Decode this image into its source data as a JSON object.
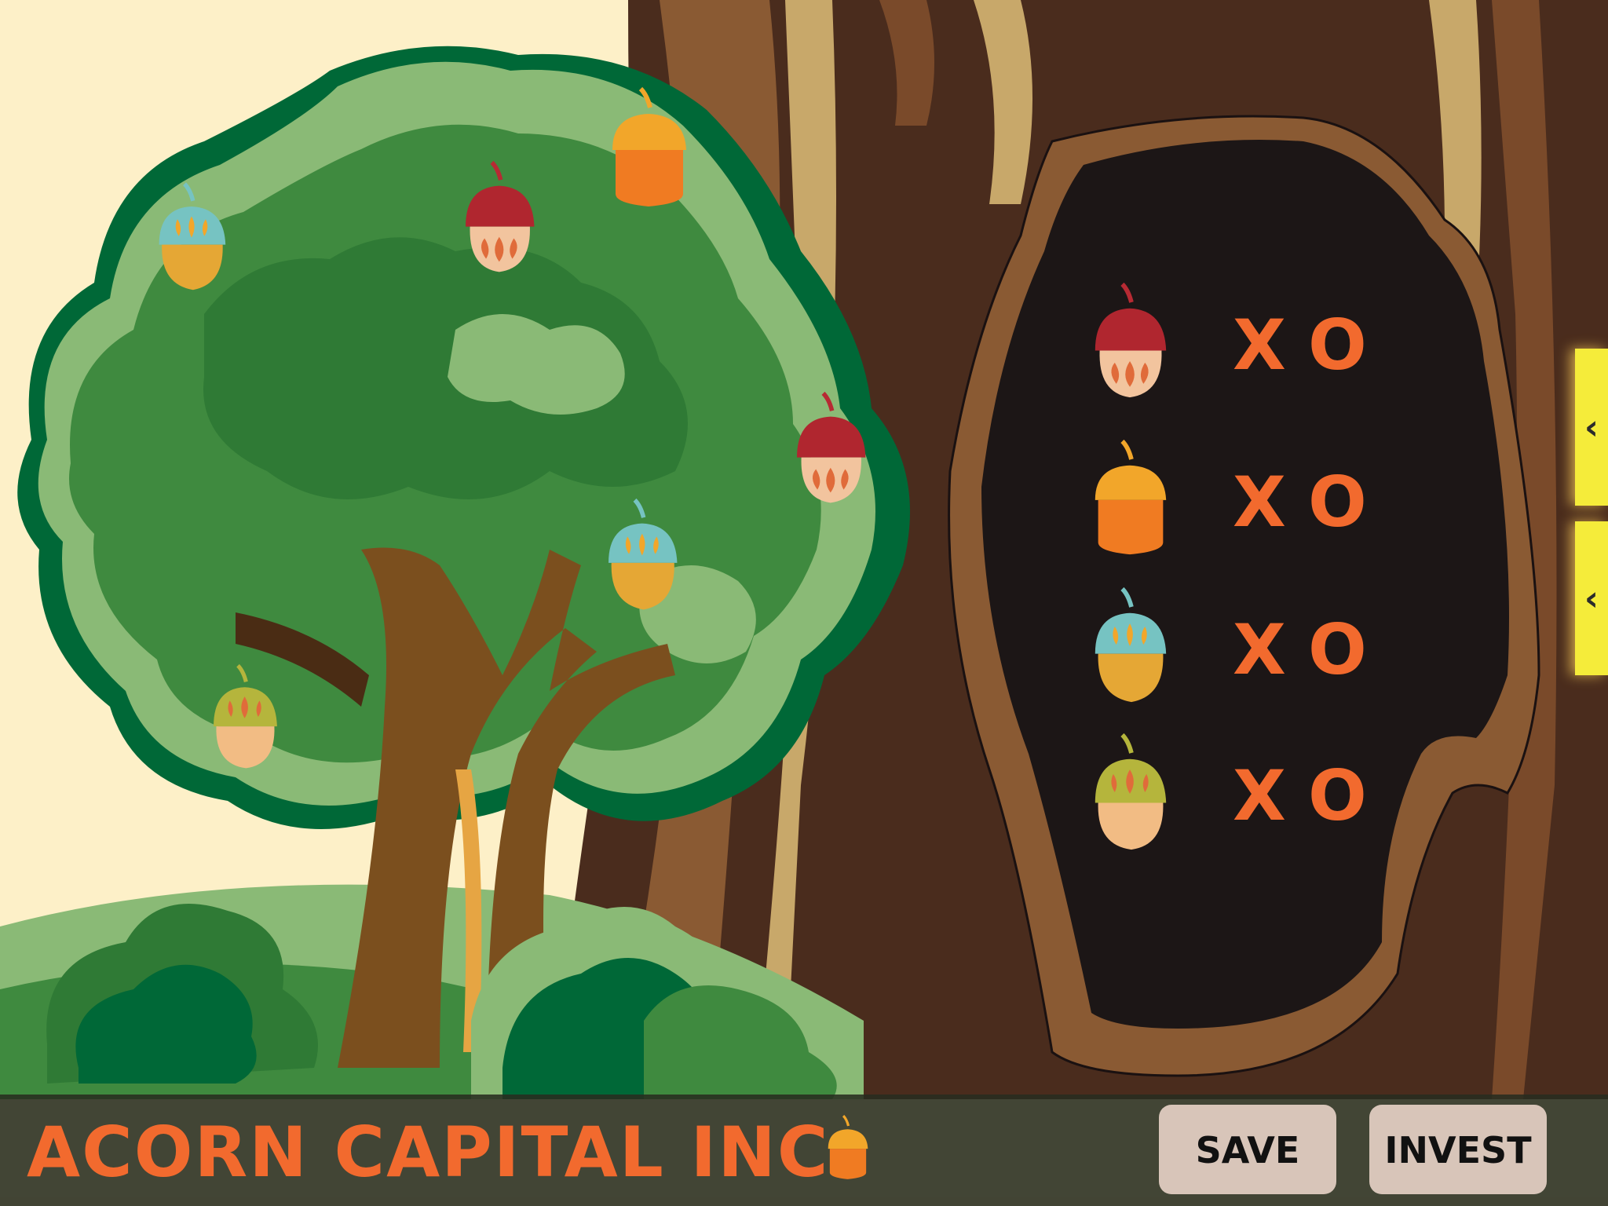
{
  "footer": {
    "brand": "ACORN CAPITAL INC.",
    "save_label": "SAVE",
    "invest_label": "INVEST"
  },
  "side_tabs": [
    {
      "label": "‹"
    },
    {
      "label": "‹"
    }
  ],
  "hollow_rows": [
    {
      "acorn": "red-acorn-icon",
      "x_label": "X",
      "o_label": "O"
    },
    {
      "acorn": "orange-acorn-icon",
      "x_label": "X",
      "o_label": "O"
    },
    {
      "acorn": "teal-acorn-icon",
      "x_label": "X",
      "o_label": "O"
    },
    {
      "acorn": "olive-acorn-icon",
      "x_label": "X",
      "o_label": "O"
    }
  ],
  "colors": {
    "sky": "#fdf0c8",
    "accent": "#f26a2e",
    "hollow": "#1c1616",
    "tab": "#f5ec3a",
    "button": "#d8c5b9"
  }
}
